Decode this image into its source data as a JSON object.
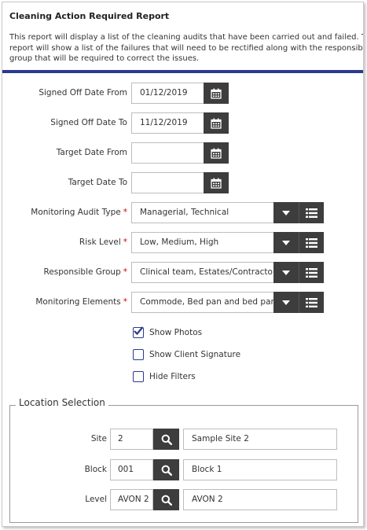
{
  "report": {
    "title": "Cleaning Action Required Report",
    "description_lines": [
      "This report will display a list of the cleaning audits that have been carried out and failed. The",
      "report will show a list of the failures that will need to be rectified along with the responsible",
      "group that will be required to correct the issues."
    ]
  },
  "filters": {
    "signed_off_from": {
      "label": "Signed Off Date From",
      "value": "01/12/2019"
    },
    "signed_off_to": {
      "label": "Signed Off Date To",
      "value": "11/12/2019"
    },
    "target_from": {
      "label": "Target Date From",
      "value": ""
    },
    "target_to": {
      "label": "Target Date To",
      "value": ""
    },
    "audit_type": {
      "label": "Monitoring Audit Type",
      "value": "Managerial, Technical",
      "required": "*"
    },
    "risk_level": {
      "label": "Risk Level",
      "value": "Low, Medium, High",
      "required": "*"
    },
    "responsible_group": {
      "label": "Responsible Group",
      "value": "Clinical team, Estates/Contractor",
      "required": "*"
    },
    "monitoring_elements": {
      "label": "Monitoring Elements",
      "value": "Commode, Bed pan and bed pan",
      "required": "*"
    }
  },
  "options": {
    "show_photos": {
      "label": "Show Photos",
      "checked": true
    },
    "show_client_signature": {
      "label": "Show Client Signature",
      "checked": false
    },
    "hide_filters": {
      "label": "Hide Filters",
      "checked": false
    }
  },
  "location": {
    "legend": "Location Selection",
    "site": {
      "label": "Site",
      "code": "2",
      "name": "Sample Site 2"
    },
    "block": {
      "label": "Block",
      "code": "001",
      "name": "Block 1"
    },
    "level": {
      "label": "Level",
      "code": "AVON 2",
      "name": "AVON 2"
    }
  },
  "icons": {
    "calendar": "calendar-icon",
    "dropdown": "caret-down-icon",
    "list": "list-icon",
    "search": "search-icon",
    "check": "checkmark-icon"
  },
  "colors": {
    "accent": "#2b3a8c",
    "button": "#3d3d3d",
    "required": "#d40000"
  }
}
